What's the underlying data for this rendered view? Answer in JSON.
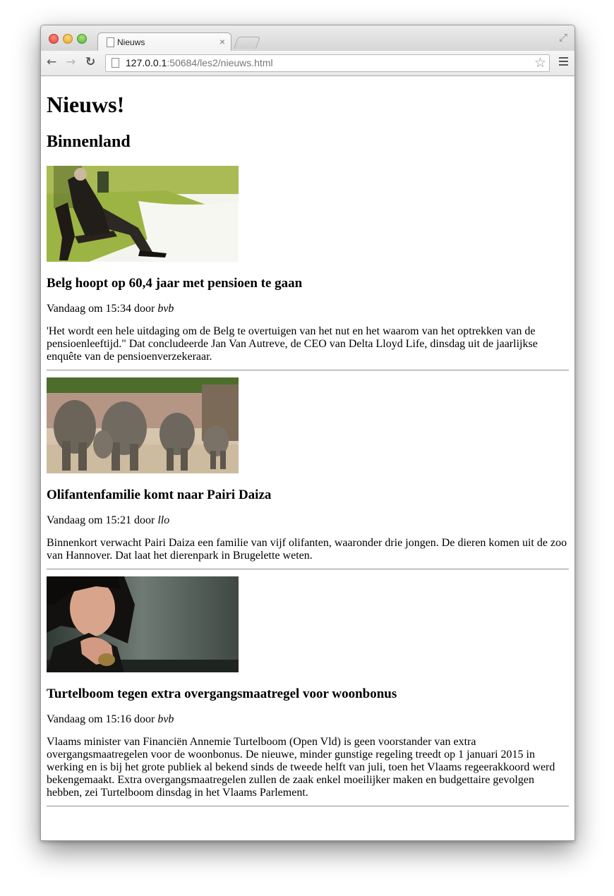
{
  "browser": {
    "tab_title": "Nieuws",
    "tab_close": "×",
    "url_host": "127.0.0.1",
    "url_rest": ":50684/les2/nieuws.html"
  },
  "page": {
    "title": "Nieuws!",
    "section": "Binnenland",
    "articles": [
      {
        "headline": "Belg hoopt op 60,4 jaar met pensioen te gaan",
        "meta_prefix": "Vandaag om 15:34 door ",
        "author": "bvb",
        "body": "'Het wordt een hele uitdaging om de Belg te overtuigen van het nut en het waarom van het optrekken van de pensioenleeftijd.\" Dat concludeerde Jan Van Autreve, de CEO van Delta Lloyd Life, dinsdag uit de jaarlijkse enquête van de pensioenverzekeraar."
      },
      {
        "headline": "Olifantenfamilie komt naar Pairi Daiza",
        "meta_prefix": "Vandaag om 15:21 door ",
        "author": "llo",
        "body": "Binnenkort verwacht Pairi Daiza een familie van vijf olifanten, waaronder drie jongen. De dieren komen uit de zoo van Hannover. Dat laat het dierenpark in Brugelette weten."
      },
      {
        "headline": "Turtelboom tegen extra overgangsmaatregel voor woonbonus",
        "meta_prefix": "Vandaag om 15:16 door ",
        "author": "bvb",
        "body": "Vlaams minister van Financiën Annemie Turtelboom (Open Vld) is geen voorstander van extra overgangsmaatregelen voor de woonbonus. De nieuwe, minder gunstige regeling treedt op 1 januari 2015 in werking en is bij het grote publiek al bekend sinds de tweede helft van juli, toen het Vlaams regeerakkoord werd bekengemaakt. Extra overgangsmaatregelen zullen de zaak enkel moeilijker maken en budgettaire gevolgen hebben, zei Turtelboom dinsdag in het Vlaams Parlement."
      }
    ]
  }
}
